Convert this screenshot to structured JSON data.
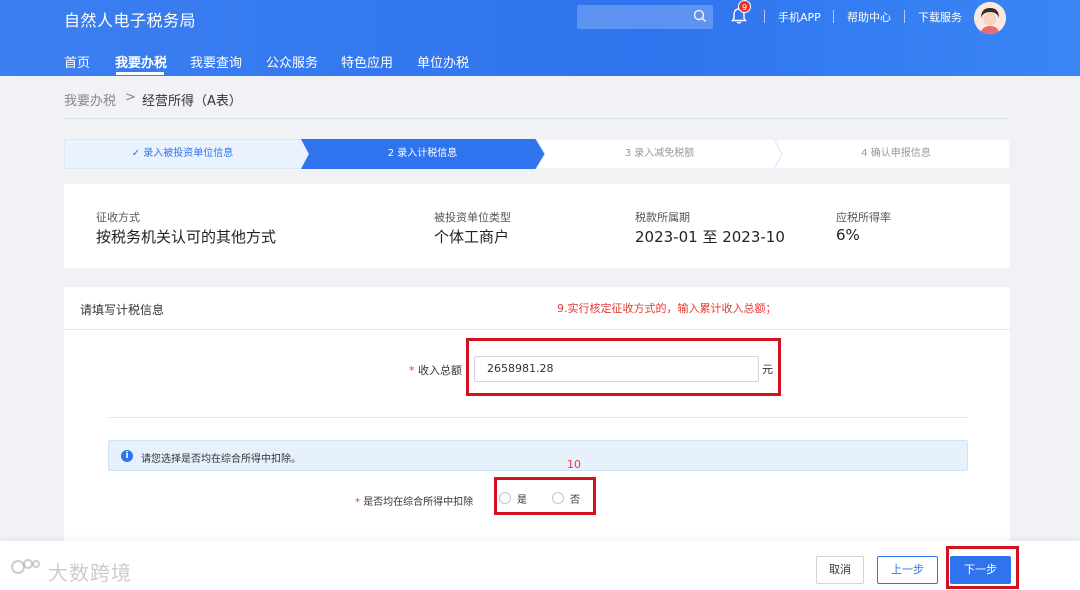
{
  "header": {
    "title": "自然人电子税务局",
    "notification_count": "9",
    "links": [
      "手机APP",
      "帮助中心",
      "下载服务"
    ],
    "nav": [
      "首页",
      "我要办税",
      "我要查询",
      "公众服务",
      "特色应用",
      "单位办税"
    ]
  },
  "breadcrumb": {
    "parent": "我要办税",
    "separator": ">",
    "current": "经营所得（A表）"
  },
  "steps": [
    {
      "label": "✓ 录入被投资单位信息"
    },
    {
      "label": "2  录入计税信息"
    },
    {
      "label": "3  录入减免税额"
    },
    {
      "label": "4  确认申报信息"
    }
  ],
  "info": {
    "method_label": "征收方式",
    "method_value": "按税务机关认可的其他方式",
    "type_label": "被投资单位类型",
    "type_value": "个体工商户",
    "period_label": "税款所属期",
    "period_value": "2023-01 至 2023-10",
    "rate_label": "应税所得率",
    "rate_value": "6%"
  },
  "form": {
    "title": "请填写计税信息",
    "annotation_note": "9.实行核定征收方式的，输入累计收入总额；",
    "income_label": "收入总额",
    "income_value": "2658981.28",
    "income_unit": "元",
    "alert_text": "请您选择是否均在综合所得中扣除。",
    "annotation_num": "10",
    "deduct_label": "是否均在综合所得中扣除",
    "option_yes": "是",
    "option_no": "否"
  },
  "footer": {
    "watermark": "大数跨境",
    "cancel": "取消",
    "prev": "上一步",
    "next": "下一步"
  },
  "colors": {
    "brand_blue": "#2f74ee",
    "highlight_red": "#d3121f"
  }
}
